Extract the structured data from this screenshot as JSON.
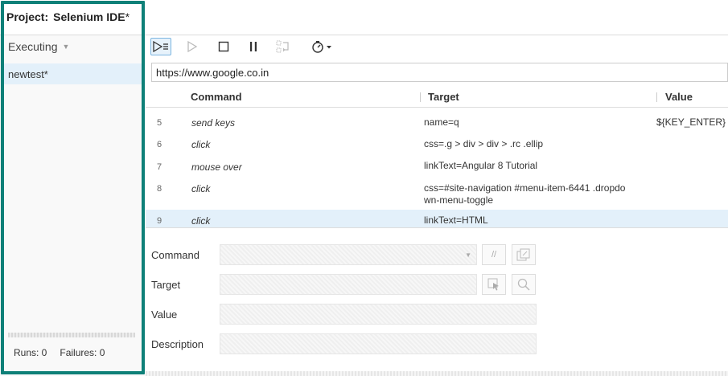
{
  "header": {
    "project_label": "Project:",
    "project_name": "Selenium IDE",
    "dirty_marker": "*"
  },
  "sidebar": {
    "mode_label": "Executing",
    "tests": [
      {
        "label": "newtest*"
      }
    ],
    "status": {
      "runs": "Runs: 0",
      "failures": "Failures: 0"
    }
  },
  "toolbar": {
    "icons": [
      "run-all-icon",
      "run-current-icon",
      "stop-icon",
      "pause-icon",
      "disable-breakpoints-icon",
      "speed-icon"
    ]
  },
  "url_bar": {
    "value": "https://www.google.co.in"
  },
  "grid": {
    "headers": {
      "command": "Command",
      "target": "Target",
      "value": "Value"
    },
    "rows": [
      {
        "num": "5",
        "command": "send keys",
        "target": "name=q",
        "value": "${KEY_ENTER}"
      },
      {
        "num": "6",
        "command": "click",
        "target": "css=.g > div > div > .rc .ellip",
        "value": ""
      },
      {
        "num": "7",
        "command": "mouse over",
        "target": "linkText=Angular 8 Tutorial",
        "value": ""
      },
      {
        "num": "8",
        "command": "click",
        "target": "css=#site-navigation #menu-item-6441 .dropdown-menu-toggle",
        "target_line1": "css=#site-navigation #menu-item-6441 .dropdo",
        "target_line2": "wn-menu-toggle",
        "value": ""
      },
      {
        "num": "9",
        "command": "click",
        "target": "linkText=HTML",
        "value": ""
      }
    ],
    "selected_row": "9"
  },
  "editor": {
    "command_label": "Command",
    "target_label": "Target",
    "value_label": "Value",
    "description_label": "Description",
    "comment_button": "//"
  },
  "colors": {
    "highlight_frame": "#0e8078",
    "selection": "#e3f0fa",
    "active_button_border": "#7bb5e0"
  }
}
